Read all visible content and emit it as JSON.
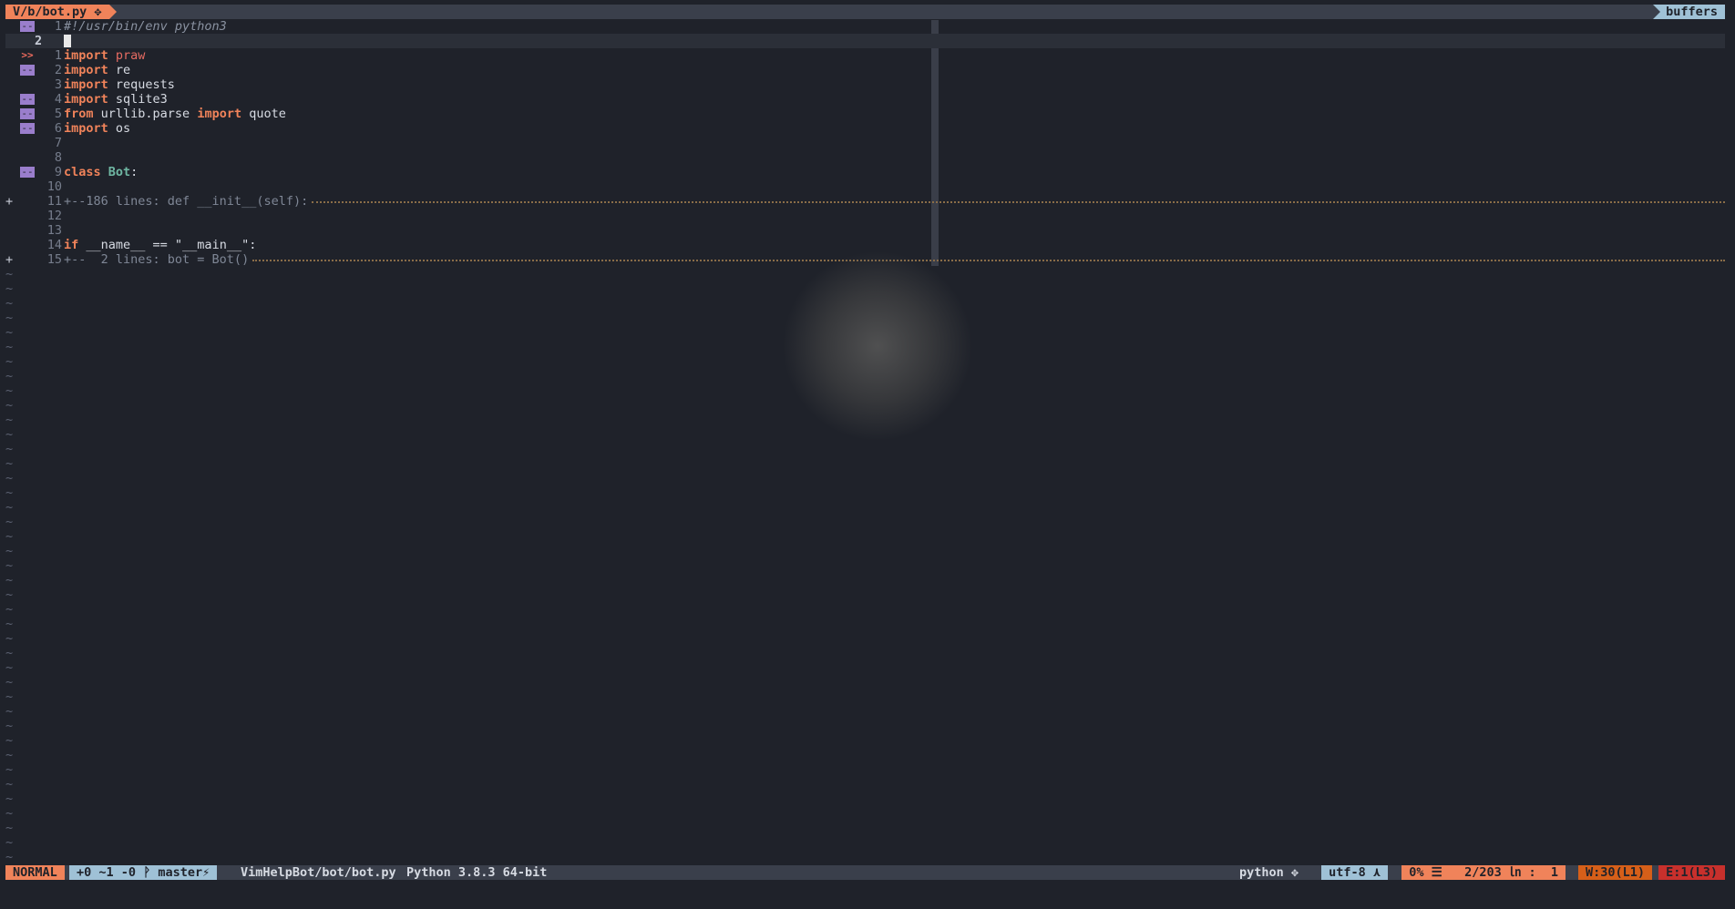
{
  "tabline": {
    "active_tab": "V/b/bot.py ✥",
    "right_label": "buffers"
  },
  "lines": [
    {
      "sign": "",
      "mark": "--",
      "num": "1",
      "cur": false,
      "parts": [
        [
          "cmt",
          "#!/usr/bin/env python3"
        ]
      ]
    },
    {
      "sign": "",
      "mark": "",
      "num": "2",
      "cur": true,
      "parts": []
    },
    {
      "sign": "",
      "mark": ">>",
      "num": "1",
      "cur": false,
      "parts": [
        [
          "kw",
          "import"
        ],
        [
          "",
          " "
        ],
        [
          "mod",
          "praw"
        ]
      ]
    },
    {
      "sign": "",
      "mark": "--",
      "num": "2",
      "cur": false,
      "parts": [
        [
          "kw",
          "import"
        ],
        [
          "",
          " re"
        ]
      ]
    },
    {
      "sign": "",
      "mark": "",
      "num": "3",
      "cur": false,
      "parts": [
        [
          "kw",
          "import"
        ],
        [
          "",
          " requests"
        ]
      ]
    },
    {
      "sign": "",
      "mark": "--",
      "num": "4",
      "cur": false,
      "parts": [
        [
          "kw",
          "import"
        ],
        [
          "",
          " sqlite3"
        ]
      ]
    },
    {
      "sign": "",
      "mark": "--",
      "num": "5",
      "cur": false,
      "parts": [
        [
          "kw",
          "from"
        ],
        [
          "",
          " urllib.parse "
        ],
        [
          "kw",
          "import"
        ],
        [
          "",
          " quote"
        ]
      ]
    },
    {
      "sign": "",
      "mark": "--",
      "num": "6",
      "cur": false,
      "parts": [
        [
          "kw",
          "import"
        ],
        [
          "",
          " os"
        ]
      ]
    },
    {
      "sign": "",
      "mark": "",
      "num": "7",
      "cur": false,
      "parts": []
    },
    {
      "sign": "",
      "mark": "",
      "num": "8",
      "cur": false,
      "parts": []
    },
    {
      "sign": "",
      "mark": "--",
      "num": "9",
      "cur": false,
      "parts": [
        [
          "kw",
          "class"
        ],
        [
          "",
          " "
        ],
        [
          "cls",
          "Bot"
        ],
        [
          "",
          ":"
        ]
      ]
    },
    {
      "sign": "",
      "mark": "",
      "num": "10",
      "cur": false,
      "parts": []
    },
    {
      "sign": "+",
      "mark": "",
      "num": "11",
      "cur": false,
      "fold": true,
      "parts": [
        [
          "",
          "+--186 lines: def __init__(self):"
        ]
      ]
    },
    {
      "sign": "",
      "mark": "",
      "num": "12",
      "cur": false,
      "parts": []
    },
    {
      "sign": "",
      "mark": "",
      "num": "13",
      "cur": false,
      "parts": []
    },
    {
      "sign": "",
      "mark": "",
      "num": "14",
      "cur": false,
      "parts": [
        [
          "kw",
          "if"
        ],
        [
          "",
          " __name__ == \"__main__\":"
        ]
      ]
    },
    {
      "sign": "+",
      "mark": "",
      "num": "15",
      "cur": false,
      "fold": true,
      "parts": [
        [
          "",
          "+--  2 lines: bot = Bot()"
        ]
      ]
    }
  ],
  "tilde_count": 41,
  "statusline": {
    "mode": "NORMAL",
    "git": "+0 ~1 -0 ᚹ master⚡",
    "file": "VimHelpBot/bot/bot.py",
    "interpreter": "Python 3.8.3 64-bit",
    "filetype": "python ✥",
    "encoding": "utf-8 ⋏",
    "position": "0% ☰   2/203 ㏑ :  1",
    "warnings": "W:30(L1)",
    "errors": "E:1(L3)"
  },
  "colors": {
    "accent": "#f0835a",
    "accent2": "#9fc1d6",
    "mark": "#9a7ecc",
    "bg": "#1f222a"
  }
}
